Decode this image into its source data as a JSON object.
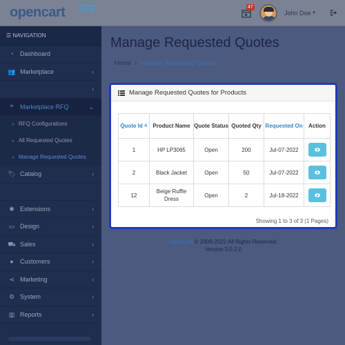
{
  "header": {
    "logo_text": "opencart",
    "notification_count": "47",
    "user_name": "John Doe"
  },
  "sidebar": {
    "nav_title": "NAVIGATION",
    "items": [
      {
        "label": "Dashboard",
        "icon": "dashboard-icon"
      },
      {
        "label": "Marketplace",
        "icon": "users-icon"
      },
      {
        "label": "",
        "icon": ""
      },
      {
        "label": "Marketplace RFQ",
        "icon": "quote-icon"
      },
      {
        "label": "Catalog",
        "icon": "tag-icon"
      },
      {
        "label": "Extensions",
        "icon": "puzzle-icon"
      },
      {
        "label": "Design",
        "icon": "monitor-icon"
      },
      {
        "label": "Sales",
        "icon": "cart-icon"
      },
      {
        "label": "Customers",
        "icon": "user-icon"
      },
      {
        "label": "Marketing",
        "icon": "share-icon"
      },
      {
        "label": "System",
        "icon": "cog-icon"
      },
      {
        "label": "Reports",
        "icon": "bar-chart-icon"
      }
    ],
    "sub_items": [
      {
        "label": "RFQ Configurations"
      },
      {
        "label": "All Requested Quotes"
      },
      {
        "label": "Manage Requested Quotes"
      }
    ]
  },
  "page": {
    "title": "Manage Requested Quotes",
    "breadcrumb": [
      "Home",
      "Manage Requested Quotes"
    ]
  },
  "panel": {
    "heading": "Manage Requested Quotes for Products",
    "columns": [
      {
        "label": "Quote Id ˄"
      },
      {
        "label": "Product Name"
      },
      {
        "label": "Quote Status"
      },
      {
        "label": "Quoted Qty"
      },
      {
        "label": "Requested On"
      },
      {
        "label": "Action"
      }
    ],
    "rows": [
      {
        "id": "1",
        "product": "HP LP3065",
        "status": "Open",
        "qty": "200",
        "date": "Jul-07-2022"
      },
      {
        "id": "2",
        "product": "Black Jacket",
        "status": "Open",
        "qty": "50",
        "date": "Jul-07-2022"
      },
      {
        "id": "12",
        "product": "Beige Ruffle Dress",
        "status": "Open",
        "qty": "2",
        "date": "Jul-18-2022"
      }
    ],
    "showing": "Showing 1 to 3 of 3 (1 Pages)"
  },
  "footer": {
    "brand": "OpenCart",
    "copyright": " © 2009-2022 All Rights Reserved.",
    "version": "Version 3.0.2.0"
  },
  "colors": {
    "accent": "#1f3ab8",
    "link": "#3a70b4",
    "info_button": "#5bc0de",
    "sidebar_bg": "#1f2d4e"
  }
}
